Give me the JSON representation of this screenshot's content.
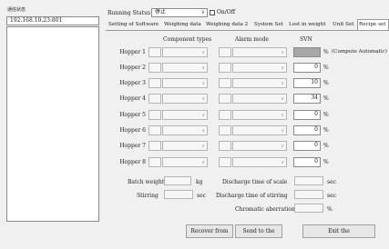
{
  "left": {
    "title": "通信状态",
    "ip": "192.168.10.23:801"
  },
  "status": {
    "label": "Running Status",
    "value": "停止",
    "onoff_label": "On/Off"
  },
  "tabs": [
    {
      "label": "Setting of Software"
    },
    {
      "label": "Weighing data"
    },
    {
      "label": "Weighing data 2"
    },
    {
      "label": "System Set"
    },
    {
      "label": "Lost in weight"
    },
    {
      "label": "Unit Set"
    },
    {
      "label": "Recipe set",
      "active": true
    }
  ],
  "recipe": {
    "col_component": "Component types",
    "col_alarm": "Alarm mode",
    "col_svn": "SVN",
    "compute_note": "(Compute Automatic)",
    "percent": "%",
    "hoppers": [
      {
        "label": "Hopper 1",
        "svn": ""
      },
      {
        "label": "Hopper 2",
        "svn": "0"
      },
      {
        "label": "Hopper 3",
        "svn": "10"
      },
      {
        "label": "Hopper 4",
        "svn": "34"
      },
      {
        "label": "Hopper 5",
        "svn": "0"
      },
      {
        "label": "Hopper 6",
        "svn": "0"
      },
      {
        "label": "Hopper 7",
        "svn": "0"
      },
      {
        "label": "Hopper 8",
        "svn": "0"
      }
    ]
  },
  "fields": {
    "batch_weight_label": "Batch weight",
    "batch_weight_unit": "kg",
    "stirring_label": "Stirring",
    "stirring_unit": "sec",
    "discharge_scale_label": "Discharge time of scale",
    "discharge_scale_unit": "sec",
    "discharge_stirring_label": "Discharge time of stirring",
    "discharge_stirring_unit": "sec",
    "chromatic_label": "Chromatic aberration",
    "chromatic_unit": "%"
  },
  "buttons": {
    "recover": "Recover from",
    "send": "Send to the",
    "exit": "Exit the"
  }
}
